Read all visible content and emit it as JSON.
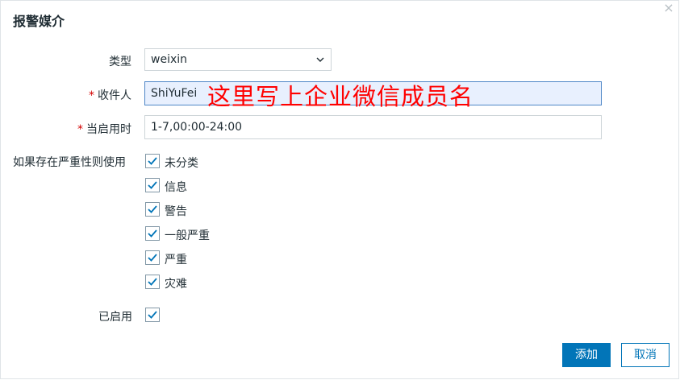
{
  "dialog": {
    "title": "报警媒介",
    "close_glyph": "×"
  },
  "form": {
    "type_label": "类型",
    "type_value": "weixin",
    "recipient_label": "收件人",
    "recipient_required": "*",
    "recipient_value": "ShiYuFei",
    "recipient_annotation": "这里写上企业微信成员名",
    "active_time_label": "当启用时",
    "active_time_required": "*",
    "active_time_value": "1-7,00:00-24:00",
    "severity_label": "如果存在严重性则使用",
    "severities": [
      {
        "label": "未分类",
        "checked": true
      },
      {
        "label": "信息",
        "checked": true
      },
      {
        "label": "警告",
        "checked": true
      },
      {
        "label": "一般严重",
        "checked": true
      },
      {
        "label": "严重",
        "checked": true
      },
      {
        "label": "灾难",
        "checked": true
      }
    ],
    "enabled_label": "已启用",
    "enabled_checked": true
  },
  "buttons": {
    "add_label": "添加",
    "cancel_label": "取消"
  },
  "colors": {
    "primary": "#0275b8",
    "required": "#d40000",
    "annotation": "#ff0000",
    "checkmark": "#0275b8"
  },
  "icons": {
    "close": "close-icon",
    "dropdown": "chevron-down-icon",
    "check": "checkmark-icon"
  }
}
